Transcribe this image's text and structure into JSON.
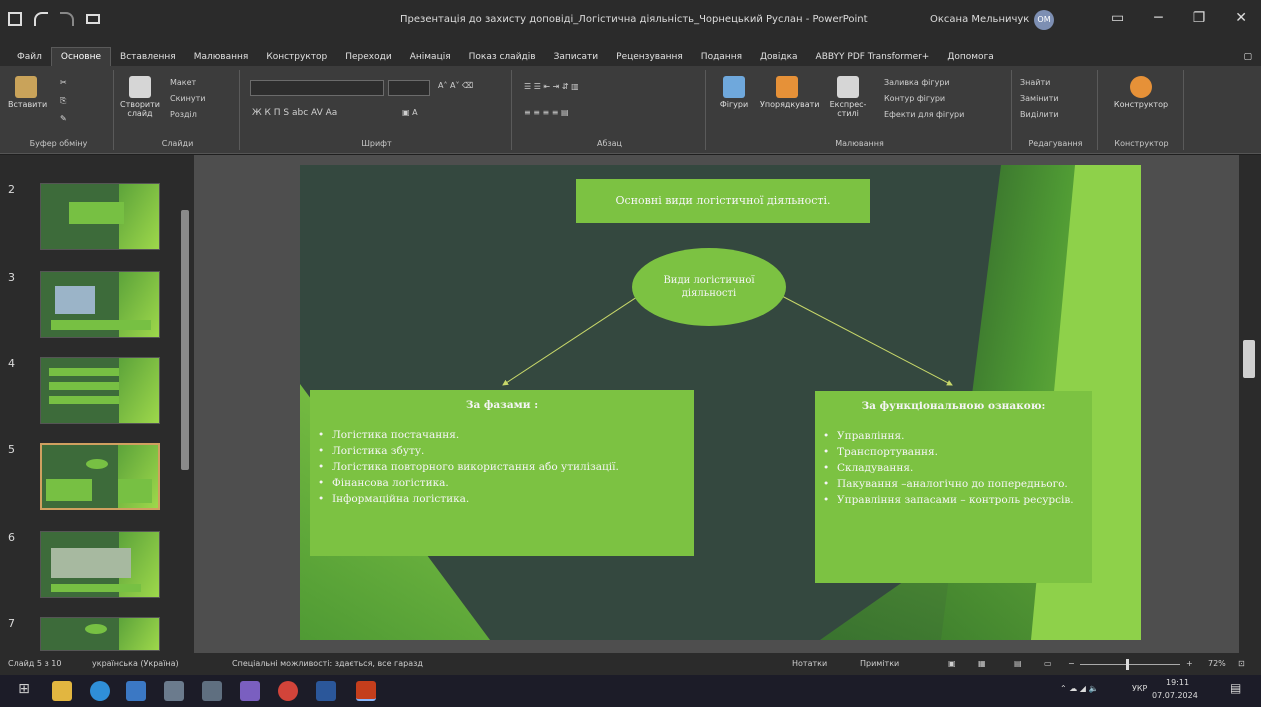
{
  "titlebar": {
    "title": "Презентація до захисту доповіді_Логістична діяльність_Чорнецький Руслан - PowerPoint",
    "user": "Оксана Мельничук",
    "avatar_initials": "ОМ"
  },
  "tabs": [
    "Файл",
    "Основне",
    "Вставлення",
    "Малювання",
    "Конструктор",
    "Переходи",
    "Анімація",
    "Показ слайдів",
    "Записати",
    "Рецензування",
    "Подання",
    "Довідка",
    "ABBYY PDF Transformer+",
    "Допомога"
  ],
  "ribbon": {
    "clipboard": {
      "paste": "Вставити",
      "label": "Буфер обміну"
    },
    "slides": {
      "new_slide": "Створити слайд",
      "layout": "Макет",
      "reset": "Скинути",
      "section": "Розділ",
      "label": "Слайди"
    },
    "font": {
      "label": "Шрифт",
      "buttons": "Ж К П S abc AV Aa"
    },
    "paragraph": {
      "label": "Абзац"
    },
    "drawing": {
      "shapes": "Фігури",
      "arrange": "Упорядкувати",
      "quick_styles": "Експрес-стилі",
      "fill": "Заливка фігури",
      "outline": "Контур фігури",
      "effects": "Ефекти для фігури",
      "label": "Малювання"
    },
    "editing": {
      "find": "Знайти",
      "replace": "Замінити",
      "select": "Виділити",
      "label": "Редагування"
    },
    "designer": {
      "button": "Конструктор",
      "label": "Конструктор"
    }
  },
  "thumbnails": [
    {
      "num": "2"
    },
    {
      "num": "3"
    },
    {
      "num": "4"
    },
    {
      "num": "5"
    },
    {
      "num": "6"
    },
    {
      "num": "7"
    }
  ],
  "slide": {
    "title": "Основні види логістичної діяльності.",
    "center": "Види логістичної діяльності",
    "left": {
      "heading": "За фазами :",
      "items": [
        "Логістика постачання.",
        "Логістика збуту.",
        "Логістика повторного використання або утилізації.",
        "Фінансова логістика.",
        "Інформаційна логістика."
      ]
    },
    "right": {
      "heading": "За функціональною ознакою:",
      "items": [
        "Управління.",
        "Транспортування.",
        "Складування.",
        "Пакування –аналогічно до попереднього.",
        "Управління запасами – контроль ресурсів."
      ]
    }
  },
  "status": {
    "slide_info": "Слайд 5 з 10",
    "language": "українська (Україна)",
    "accessibility": "Спеціальні можливості: здається, все гаразд",
    "notes": "Нотатки",
    "comments": "Примітки",
    "zoom": "72%"
  },
  "taskbar": {
    "lang": "УКР",
    "time": "19:11",
    "date": "07.07.2024"
  }
}
